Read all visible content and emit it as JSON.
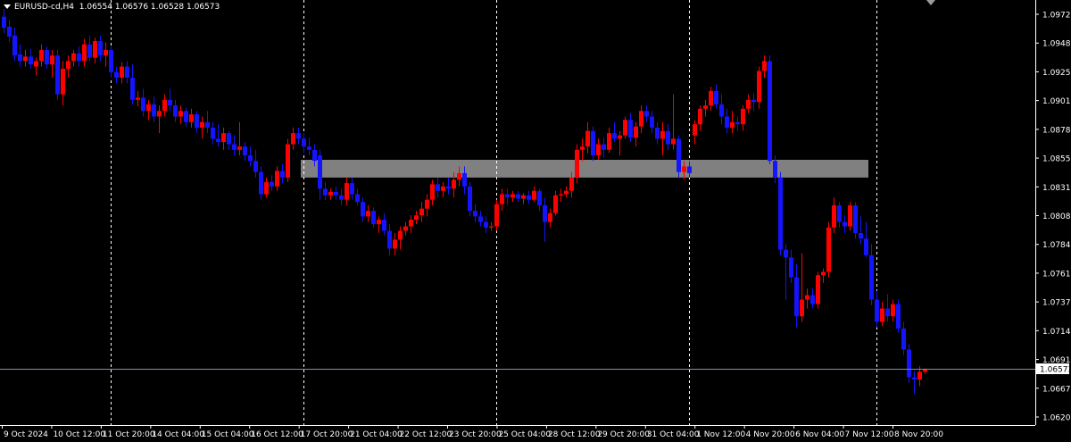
{
  "header": {
    "symbol": "EURUSD-cd,H4",
    "ohlc": "1.06554 1.06576 1.06528 1.06573"
  },
  "colors": {
    "background": "#000000",
    "bull": "#ff0000",
    "bear": "#1414ff",
    "grid": "#ffffff",
    "axis": "#ffffff",
    "zone": "#808080",
    "price_line": "#7f8fa6"
  },
  "chart_data": {
    "type": "candlestick",
    "y_ticks": [
      "1.09720",
      "1.09485",
      "1.09250",
      "1.09015",
      "1.08780",
      "1.08550",
      "1.08315",
      "1.08080",
      "1.07845",
      "1.07610",
      "1.07375",
      "1.07143",
      "1.06910",
      "1.06675",
      "1.06205"
    ],
    "ylim": [
      1.0607,
      1.099
    ],
    "x_ticks": [
      "9 Oct 2024",
      "10 Oct 12:00",
      "11 Oct 20:00",
      "14 Oct 04:00",
      "15 Oct 04:00",
      "16 Oct 12:00",
      "17 Oct 20:00",
      "21 Oct 04:00",
      "22 Oct 12:00",
      "23 Oct 20:00",
      "25 Oct 04:00",
      "28 Oct 12:00",
      "29 Oct 20:00",
      "31 Oct 04:00",
      "1 Nov 12:00",
      "4 Nov 20:00",
      "6 Nov 04:00",
      "7 Nov 12:00",
      "8 Nov 20:00"
    ],
    "current_price": "1.06573",
    "zone": {
      "low": 1.083,
      "high": 1.0846,
      "from_bar": 56,
      "to_bar": 161
    },
    "separators": [
      20,
      56,
      92,
      128,
      163
    ],
    "candles": [
      [
        1.0975,
        1.0982,
        1.096,
        1.0965
      ],
      [
        1.0966,
        1.0972,
        1.0952,
        1.0957
      ],
      [
        1.0958,
        1.0965,
        1.0935,
        1.094
      ],
      [
        1.0941,
        1.095,
        1.093,
        1.0935
      ],
      [
        1.0935,
        1.0945,
        1.093,
        1.0939
      ],
      [
        1.0939,
        1.0946,
        1.0928,
        1.0932
      ],
      [
        1.093,
        1.0938,
        1.0922,
        1.0935
      ],
      [
        1.0935,
        1.095,
        1.093,
        1.0945
      ],
      [
        1.0945,
        1.0948,
        1.0928,
        1.0932
      ],
      [
        1.0932,
        1.0945,
        1.092,
        1.094
      ],
      [
        1.094,
        1.0945,
        1.09,
        1.0905
      ],
      [
        1.0905,
        1.0935,
        1.0895,
        1.0928
      ],
      [
        1.0928,
        1.094,
        1.092,
        1.0935
      ],
      [
        1.0935,
        1.0945,
        1.093,
        1.0942
      ],
      [
        1.0942,
        1.0948,
        1.093,
        1.0935
      ],
      [
        1.0935,
        1.0955,
        1.093,
        1.095
      ],
      [
        1.095,
        1.0958,
        1.0935,
        1.0938
      ],
      [
        1.0938,
        1.0956,
        1.0933,
        1.0953
      ],
      [
        1.0953,
        1.0958,
        1.0935,
        1.094
      ],
      [
        1.094,
        1.0952,
        1.093,
        1.0945
      ],
      [
        1.0945,
        1.0948,
        1.092,
        1.0925
      ],
      [
        1.0925,
        1.093,
        1.0915,
        1.092
      ],
      [
        1.092,
        1.0934,
        1.0915,
        1.093
      ],
      [
        1.093,
        1.0935,
        1.0915,
        1.092
      ],
      [
        1.092,
        1.0932,
        1.0896,
        1.09
      ],
      [
        1.09,
        1.0908,
        1.0894,
        1.0902
      ],
      [
        1.0902,
        1.091,
        1.0885,
        1.089
      ],
      [
        1.089,
        1.09,
        1.0882,
        1.0896
      ],
      [
        1.0896,
        1.0903,
        1.088,
        1.0885
      ],
      [
        1.0885,
        1.0895,
        1.087,
        1.089
      ],
      [
        1.089,
        1.0905,
        1.0885,
        1.09
      ],
      [
        1.09,
        1.091,
        1.089,
        1.0895
      ],
      [
        1.0895,
        1.09,
        1.088,
        1.0885
      ],
      [
        1.0885,
        1.0895,
        1.0878,
        1.089
      ],
      [
        1.089,
        1.0893,
        1.0876,
        1.088
      ],
      [
        1.088,
        1.0892,
        1.0875,
        1.0887
      ],
      [
        1.0887,
        1.089,
        1.087,
        1.0875
      ],
      [
        1.0875,
        1.0885,
        1.0865,
        1.088
      ],
      [
        1.088,
        1.089,
        1.087,
        1.0875
      ],
      [
        1.0875,
        1.088,
        1.086,
        1.0865
      ],
      [
        1.0865,
        1.0878,
        1.0858,
        1.0862
      ],
      [
        1.0862,
        1.0875,
        1.0855,
        1.087
      ],
      [
        1.087,
        1.0872,
        1.0855,
        1.086
      ],
      [
        1.086,
        1.0868,
        1.085,
        1.0855
      ],
      [
        1.0855,
        1.088,
        1.085,
        1.0858
      ],
      [
        1.0858,
        1.0862,
        1.0845,
        1.085
      ],
      [
        1.085,
        1.0858,
        1.084,
        1.0845
      ],
      [
        1.0845,
        1.0855,
        1.083,
        1.0835
      ],
      [
        1.0835,
        1.084,
        1.081,
        1.0815
      ],
      [
        1.0815,
        1.083,
        1.0812,
        1.0826
      ],
      [
        1.0826,
        1.0832,
        1.0818,
        1.0822
      ],
      [
        1.0822,
        1.084,
        1.0818,
        1.0836
      ],
      [
        1.0836,
        1.0842,
        1.0825,
        1.083
      ],
      [
        1.083,
        1.0865,
        1.0826,
        1.086
      ],
      [
        1.086,
        1.0875,
        1.0855,
        1.087
      ],
      [
        1.087,
        1.0875,
        1.086,
        1.0865
      ],
      [
        1.0865,
        1.087,
        1.0852,
        1.0858
      ],
      [
        1.0858,
        1.0866,
        1.085,
        1.0855
      ],
      [
        1.0855,
        1.086,
        1.084,
        1.0845
      ],
      [
        1.085,
        1.0855,
        1.081,
        1.082
      ],
      [
        1.082,
        1.0826,
        1.081,
        1.0814
      ],
      [
        1.0814,
        1.082,
        1.081,
        1.0817
      ],
      [
        1.0817,
        1.0822,
        1.081,
        1.0814
      ],
      [
        1.0814,
        1.082,
        1.0805,
        1.081
      ],
      [
        1.081,
        1.083,
        1.0805,
        1.0825
      ],
      [
        1.0825,
        1.083,
        1.081,
        1.0815
      ],
      [
        1.0815,
        1.082,
        1.0805,
        1.0808
      ],
      [
        1.0808,
        1.0812,
        1.079,
        1.0795
      ],
      [
        1.0795,
        1.0805,
        1.079,
        1.08
      ],
      [
        1.08,
        1.0803,
        1.0785,
        1.0788
      ],
      [
        1.0788,
        1.0795,
        1.078,
        1.0792
      ],
      [
        1.0792,
        1.0798,
        1.0778,
        1.0782
      ],
      [
        1.0782,
        1.0788,
        1.076,
        1.0766
      ],
      [
        1.0766,
        1.078,
        1.076,
        1.0774
      ],
      [
        1.0774,
        1.0786,
        1.0765,
        1.0782
      ],
      [
        1.0782,
        1.079,
        1.0778,
        1.0786
      ],
      [
        1.0786,
        1.0796,
        1.078,
        1.0792
      ],
      [
        1.0792,
        1.08,
        1.0788,
        1.0796
      ],
      [
        1.0796,
        1.0808,
        1.079,
        1.0802
      ],
      [
        1.0802,
        1.0815,
        1.0795,
        1.081
      ],
      [
        1.081,
        1.0828,
        1.0805,
        1.0824
      ],
      [
        1.0824,
        1.083,
        1.0812,
        1.0818
      ],
      [
        1.0818,
        1.0826,
        1.0812,
        1.0822
      ],
      [
        1.0822,
        1.083,
        1.0815,
        1.082
      ],
      [
        1.082,
        1.0835,
        1.0812,
        1.0828
      ],
      [
        1.0828,
        1.084,
        1.0822,
        1.0834
      ],
      [
        1.0834,
        1.084,
        1.0815,
        1.0822
      ],
      [
        1.0822,
        1.0826,
        1.0795,
        1.08
      ],
      [
        1.08,
        1.0806,
        1.079,
        1.0795
      ],
      [
        1.0795,
        1.08,
        1.0786,
        1.079
      ],
      [
        1.079,
        1.0795,
        1.078,
        1.0785
      ],
      [
        1.0785,
        1.079,
        1.0782,
        1.0786
      ],
      [
        1.0786,
        1.081,
        1.0782,
        1.0806
      ],
      [
        1.0806,
        1.082,
        1.08,
        1.0815
      ],
      [
        1.0815,
        1.082,
        1.0805,
        1.0812
      ],
      [
        1.0812,
        1.0818,
        1.0808,
        1.0815
      ],
      [
        1.0815,
        1.0818,
        1.0808,
        1.0811
      ],
      [
        1.0811,
        1.0816,
        1.0806,
        1.0814
      ],
      [
        1.0814,
        1.0818,
        1.0806,
        1.081
      ],
      [
        1.081,
        1.0822,
        1.0808,
        1.0818
      ],
      [
        1.0818,
        1.082,
        1.08,
        1.0805
      ],
      [
        1.0805,
        1.0812,
        1.0772,
        1.079
      ],
      [
        1.079,
        1.0802,
        1.0785,
        1.0798
      ],
      [
        1.0798,
        1.0818,
        1.0796,
        1.0814
      ],
      [
        1.0814,
        1.082,
        1.0808,
        1.0815
      ],
      [
        1.0815,
        1.0822,
        1.0812,
        1.0818
      ],
      [
        1.0818,
        1.0835,
        1.0812,
        1.083
      ],
      [
        1.083,
        1.086,
        1.0825,
        1.0855
      ],
      [
        1.0855,
        1.0865,
        1.0845,
        1.0858
      ],
      [
        1.0858,
        1.088,
        1.0852,
        1.0872
      ],
      [
        1.0872,
        1.0876,
        1.0845,
        1.085
      ],
      [
        1.085,
        1.0865,
        1.0846,
        1.086
      ],
      [
        1.086,
        1.0866,
        1.0848,
        1.0855
      ],
      [
        1.0855,
        1.0875,
        1.0852,
        1.087
      ],
      [
        1.087,
        1.088,
        1.0862,
        1.0865
      ],
      [
        1.0865,
        1.0872,
        1.085,
        1.0868
      ],
      [
        1.0868,
        1.0885,
        1.0865,
        1.0882
      ],
      [
        1.0882,
        1.0888,
        1.0862,
        1.0866
      ],
      [
        1.0866,
        1.088,
        1.0858,
        1.0876
      ],
      [
        1.0876,
        1.0895,
        1.087,
        1.089
      ],
      [
        1.089,
        1.0895,
        1.088,
        1.0885
      ],
      [
        1.0885,
        1.089,
        1.087,
        1.0875
      ],
      [
        1.0875,
        1.088,
        1.086,
        1.0865
      ],
      [
        1.0865,
        1.088,
        1.085,
        1.0872
      ],
      [
        1.0872,
        1.0878,
        1.0855,
        1.086
      ],
      [
        1.086,
        1.0905,
        1.0855,
        1.0865
      ],
      [
        1.0865,
        1.0868,
        1.083,
        1.0835
      ],
      [
        1.0835,
        1.0845,
        1.0828,
        1.084
      ],
      [
        1.084,
        1.0845,
        1.083,
        1.0834
      ],
      [
        1.0868,
        1.0882,
        1.086,
        1.0878
      ],
      [
        1.0878,
        1.0895,
        1.0872,
        1.0892
      ],
      [
        1.0892,
        1.09,
        1.0885,
        1.0895
      ],
      [
        1.0895,
        1.0912,
        1.089,
        1.0908
      ],
      [
        1.0908,
        1.0914,
        1.0892,
        1.0896
      ],
      [
        1.0896,
        1.0905,
        1.0878,
        1.0885
      ],
      [
        1.0885,
        1.0892,
        1.087,
        1.0875
      ],
      [
        1.0875,
        1.089,
        1.087,
        1.088
      ],
      [
        1.088,
        1.0885,
        1.0872,
        1.0878
      ],
      [
        1.0878,
        1.0895,
        1.0872,
        1.0892
      ],
      [
        1.0892,
        1.0905,
        1.0888,
        1.09
      ],
      [
        1.09,
        1.0906,
        1.089,
        1.0898
      ],
      [
        1.0898,
        1.093,
        1.0892,
        1.0926
      ],
      [
        1.0926,
        1.094,
        1.092,
        1.0935
      ],
      [
        1.0935,
        1.094,
        1.0842,
        1.0845
      ],
      [
        1.0845,
        1.085,
        1.0825,
        1.083
      ],
      [
        1.083,
        1.0835,
        1.076,
        1.0765
      ],
      [
        1.0765,
        1.077,
        1.072,
        1.0758
      ],
      [
        1.0758,
        1.0765,
        1.0735,
        1.074
      ],
      [
        1.074,
        1.0752,
        1.0695,
        1.0705
      ],
      [
        1.0705,
        1.0762,
        1.07,
        1.072
      ],
      [
        1.072,
        1.073,
        1.0712,
        1.0724
      ],
      [
        1.0724,
        1.073,
        1.0712,
        1.0716
      ],
      [
        1.0716,
        1.0745,
        1.0712,
        1.0742
      ],
      [
        1.0742,
        1.0748,
        1.0735,
        1.0745
      ],
      [
        1.0745,
        1.079,
        1.074,
        1.0785
      ],
      [
        1.0785,
        1.0812,
        1.078,
        1.0805
      ],
      [
        1.0805,
        1.0808,
        1.0785,
        1.079
      ],
      [
        1.079,
        1.0796,
        1.078,
        1.0786
      ],
      [
        1.0786,
        1.0808,
        1.0782,
        1.0805
      ],
      [
        1.0805,
        1.0808,
        1.0775,
        1.078
      ],
      [
        1.078,
        1.0795,
        1.077,
        1.0775
      ],
      [
        1.0775,
        1.079,
        1.0758,
        1.076
      ],
      [
        1.076,
        1.077,
        1.0715,
        1.072
      ],
      [
        1.072,
        1.0728,
        1.0695,
        1.07
      ],
      [
        1.07,
        1.0718,
        1.0696,
        1.0712
      ],
      [
        1.0712,
        1.0725,
        1.07,
        1.0705
      ],
      [
        1.0705,
        1.072,
        1.07,
        1.0716
      ],
      [
        1.0716,
        1.072,
        1.069,
        1.0694
      ],
      [
        1.0694,
        1.07,
        1.067,
        1.0675
      ],
      [
        1.0675,
        1.068,
        1.0645,
        1.065
      ],
      [
        1.065,
        1.0656,
        1.0635,
        1.0648
      ],
      [
        1.0648,
        1.066,
        1.0642,
        1.0655
      ],
      [
        1.0655,
        1.0658,
        1.0653,
        1.0657
      ]
    ]
  }
}
